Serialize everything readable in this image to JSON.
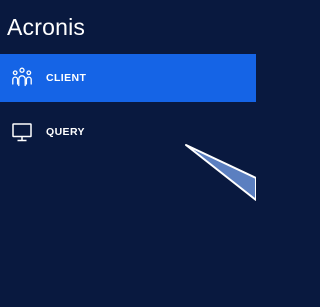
{
  "brand": {
    "logo_text": "Acronis"
  },
  "sidebar": {
    "items": [
      {
        "label": "CLIENT",
        "icon": "users-group-icon",
        "active": true
      },
      {
        "label": "QUERY",
        "icon": "monitor-icon",
        "active": false
      }
    ]
  },
  "colors": {
    "background": "#09193f",
    "active_item": "#1564e6",
    "text": "#ffffff",
    "callout_fill": "#5b7fc0"
  }
}
